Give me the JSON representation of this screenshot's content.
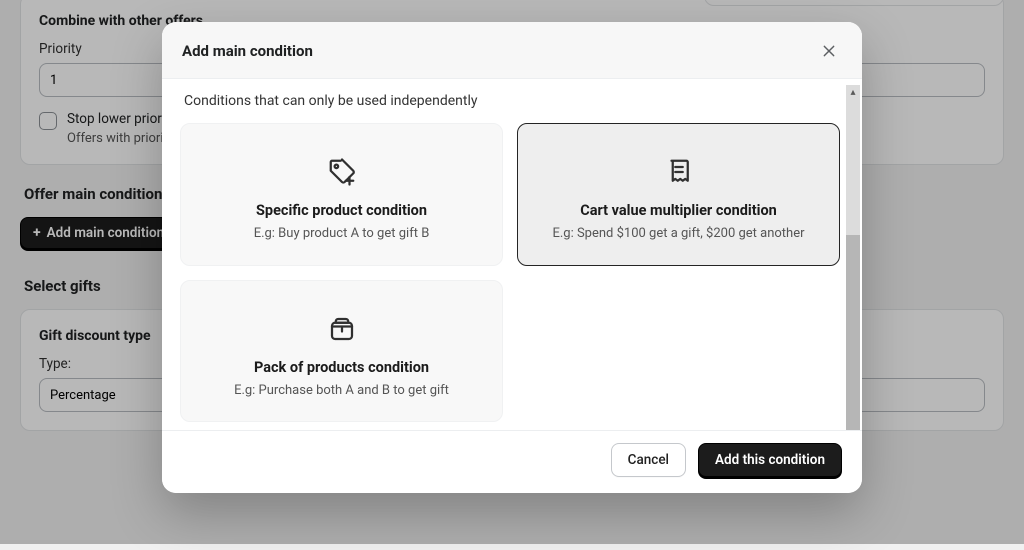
{
  "background": {
    "combine": {
      "title": "Combine with other offers",
      "priority_label": "Priority",
      "priority_value": "1",
      "stop_lower_label": "Stop lower priority",
      "stop_lower_help": "Offers with priority"
    },
    "main_condition": {
      "title": "Offer main condition",
      "add_button": "Add main condition",
      "plus": "+"
    },
    "gifts": {
      "title": "Select gifts",
      "discount_type_heading": "Gift discount type",
      "type_label": "Type:",
      "type_value": "Percentage"
    }
  },
  "modal": {
    "title": "Add main condition",
    "subtitle": "Conditions that can only be used independently",
    "options": [
      {
        "id": "specific-product",
        "title": "Specific product condition",
        "example": "E.g: Buy product A to get gift B",
        "selected": false,
        "icon": "tag"
      },
      {
        "id": "cart-multiplier",
        "title": "Cart value multiplier condition",
        "example": "E.g: Spend $100 get a gift, $200 get another",
        "selected": true,
        "icon": "receipt"
      },
      {
        "id": "pack-products",
        "title": "Pack of products condition",
        "example": "E.g: Purchase both A and B to get gift",
        "selected": false,
        "icon": "box"
      }
    ],
    "cancel": "Cancel",
    "confirm": "Add this condition"
  }
}
